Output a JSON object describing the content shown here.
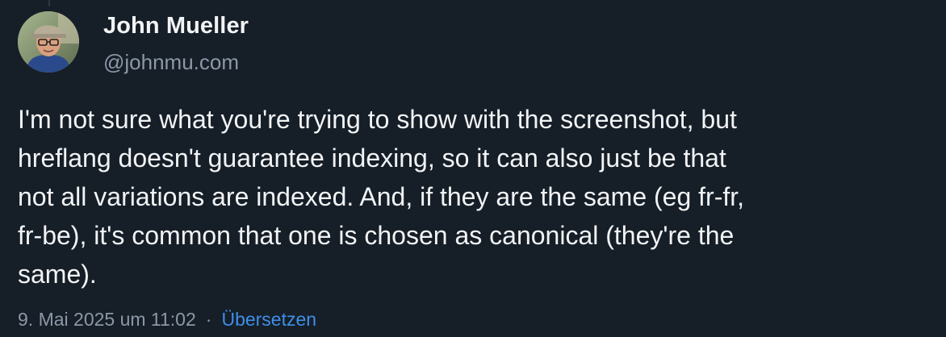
{
  "author": {
    "name": "John Mueller",
    "handle": "@johnmu.com"
  },
  "post": {
    "lines": [
      "I'm not sure what you're trying to show with the screenshot, but",
      "hreflang doesn't guarantee indexing, so it can also just be that",
      "not all variations are indexed. And, if they are the same (eg fr-fr,",
      "fr-be), it's common that one is chosen as canonical (they're the",
      "same)."
    ]
  },
  "meta": {
    "timestamp": "9. Mai 2025 um 11:02",
    "separator": "·",
    "translate_label": "Übersetzen"
  },
  "colors": {
    "background": "#161e27",
    "text": "#f1f3f5",
    "muted": "#8c98a7",
    "link": "#3e8fe8"
  }
}
